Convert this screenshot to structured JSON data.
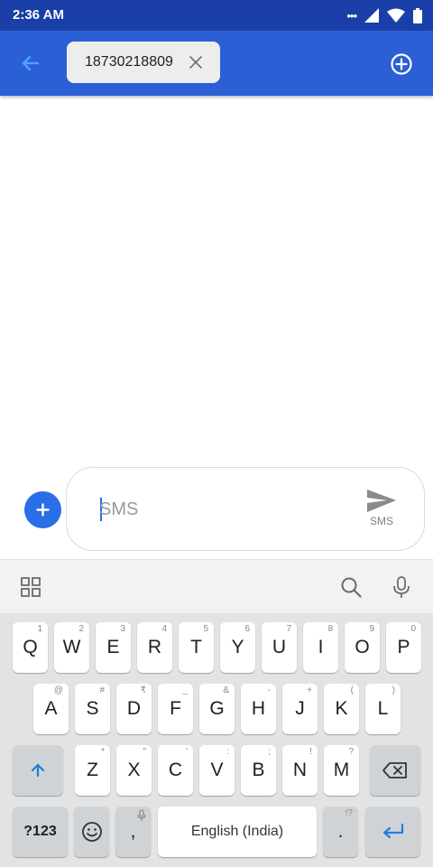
{
  "status_bar": {
    "time": "2:36 AM",
    "icons": [
      "more-dots-icon",
      "cell-signal-icon",
      "wifi-icon",
      "battery-icon"
    ]
  },
  "app_bar": {
    "back_icon": "arrow-left-icon",
    "recipient_chip": {
      "label": "18730218809",
      "remove_icon": "close-icon"
    },
    "add_icon": "plus-circle-icon"
  },
  "compose": {
    "attach_icon": "plus-icon",
    "placeholder": "SMS",
    "send_icon": "send-icon",
    "send_label": "SMS"
  },
  "keyboard_toolbar": {
    "left_icon": "grid-icon",
    "right_icons": [
      "search-icon",
      "microphone-icon"
    ]
  },
  "keyboard": {
    "row1": [
      {
        "label": "Q",
        "hint": "1"
      },
      {
        "label": "W",
        "hint": "2"
      },
      {
        "label": "E",
        "hint": "3"
      },
      {
        "label": "R",
        "hint": "4"
      },
      {
        "label": "T",
        "hint": "5"
      },
      {
        "label": "Y",
        "hint": "6"
      },
      {
        "label": "U",
        "hint": "7"
      },
      {
        "label": "I",
        "hint": "8"
      },
      {
        "label": "O",
        "hint": "9"
      },
      {
        "label": "P",
        "hint": "0"
      }
    ],
    "row2": [
      {
        "label": "A",
        "hint": "@"
      },
      {
        "label": "S",
        "hint": "#"
      },
      {
        "label": "D",
        "hint": "₹"
      },
      {
        "label": "F",
        "hint": "_"
      },
      {
        "label": "G",
        "hint": "&"
      },
      {
        "label": "H",
        "hint": "-"
      },
      {
        "label": "J",
        "hint": "+"
      },
      {
        "label": "K",
        "hint": "("
      },
      {
        "label": "L",
        "hint": ")"
      }
    ],
    "row3": [
      {
        "label": "Z",
        "hint": "*"
      },
      {
        "label": "X",
        "hint": "\""
      },
      {
        "label": "C",
        "hint": "'"
      },
      {
        "label": "V",
        "hint": ":"
      },
      {
        "label": "B",
        "hint": ";"
      },
      {
        "label": "N",
        "hint": "!"
      },
      {
        "label": "M",
        "hint": "?"
      }
    ],
    "shift_icon": "shift-arrow-icon",
    "backspace_icon": "backspace-icon",
    "symbols_label": "?123",
    "emoji_icon": "emoji-icon",
    "comma": {
      "label": ",",
      "hint_icon": "microphone-icon"
    },
    "space_label": "English (India)",
    "period": {
      "label": ".",
      "hint": "!?"
    },
    "enter_icon": "enter-arrow-icon"
  },
  "colors": {
    "status_bar": "#1b3fa8",
    "app_bar": "#2a5fd6",
    "accent": "#2a6ee8"
  }
}
